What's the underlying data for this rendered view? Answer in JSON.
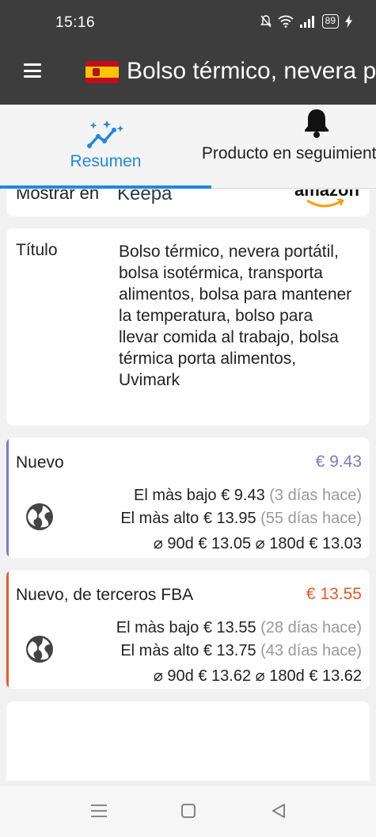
{
  "status_bar": {
    "time": "15:16",
    "battery": "89"
  },
  "app_bar": {
    "title": "Bolso térmico, nevera p",
    "flag": "spain-flag-icon"
  },
  "tabs": [
    {
      "label": "Resumen",
      "icon": "chart-sparkle-icon",
      "active": true
    },
    {
      "label": "Producto en seguimiento",
      "icon": "bell-icon",
      "active": false
    }
  ],
  "peek": {
    "show_in": "Mostrar en",
    "keepa": "Keepa",
    "amazon": "amazon"
  },
  "details": {
    "title_label": "Título",
    "title_value": "Bolso térmico, nevera portátil, bolsa isotérmica, transporta alimentos, bolsa para mantener la temperatura, bolso para llevar comida al trabajo, bolsa térmica porta alimentos, Uvimark"
  },
  "offers": [
    {
      "name": "Nuevo",
      "price": "€ 9.43",
      "lowest_label": "El màs bajo",
      "lowest_value": "€ 9.43",
      "lowest_ago": "(3 días hace)",
      "highest_label": "El màs alto",
      "highest_value": "€ 13.95",
      "highest_ago": "(55 días hace)",
      "avg": "⌀ 90d € 13.05 ⌀ 180d € 13.03",
      "color": "#7b7bc8"
    },
    {
      "name": "Nuevo, de terceros FBA",
      "price": "€ 13.55",
      "lowest_label": "El màs bajo",
      "lowest_value": "€ 13.55",
      "lowest_ago": "(28 días hace)",
      "highest_label": "El màs alto",
      "highest_value": "€ 13.75",
      "highest_ago": "(43 días hace)",
      "avg": "⌀ 90d € 13.62 ⌀ 180d € 13.62",
      "color": "#e8582a"
    }
  ],
  "colors": {
    "accent": "#1e88e5",
    "bar": "#3d3d3d"
  }
}
